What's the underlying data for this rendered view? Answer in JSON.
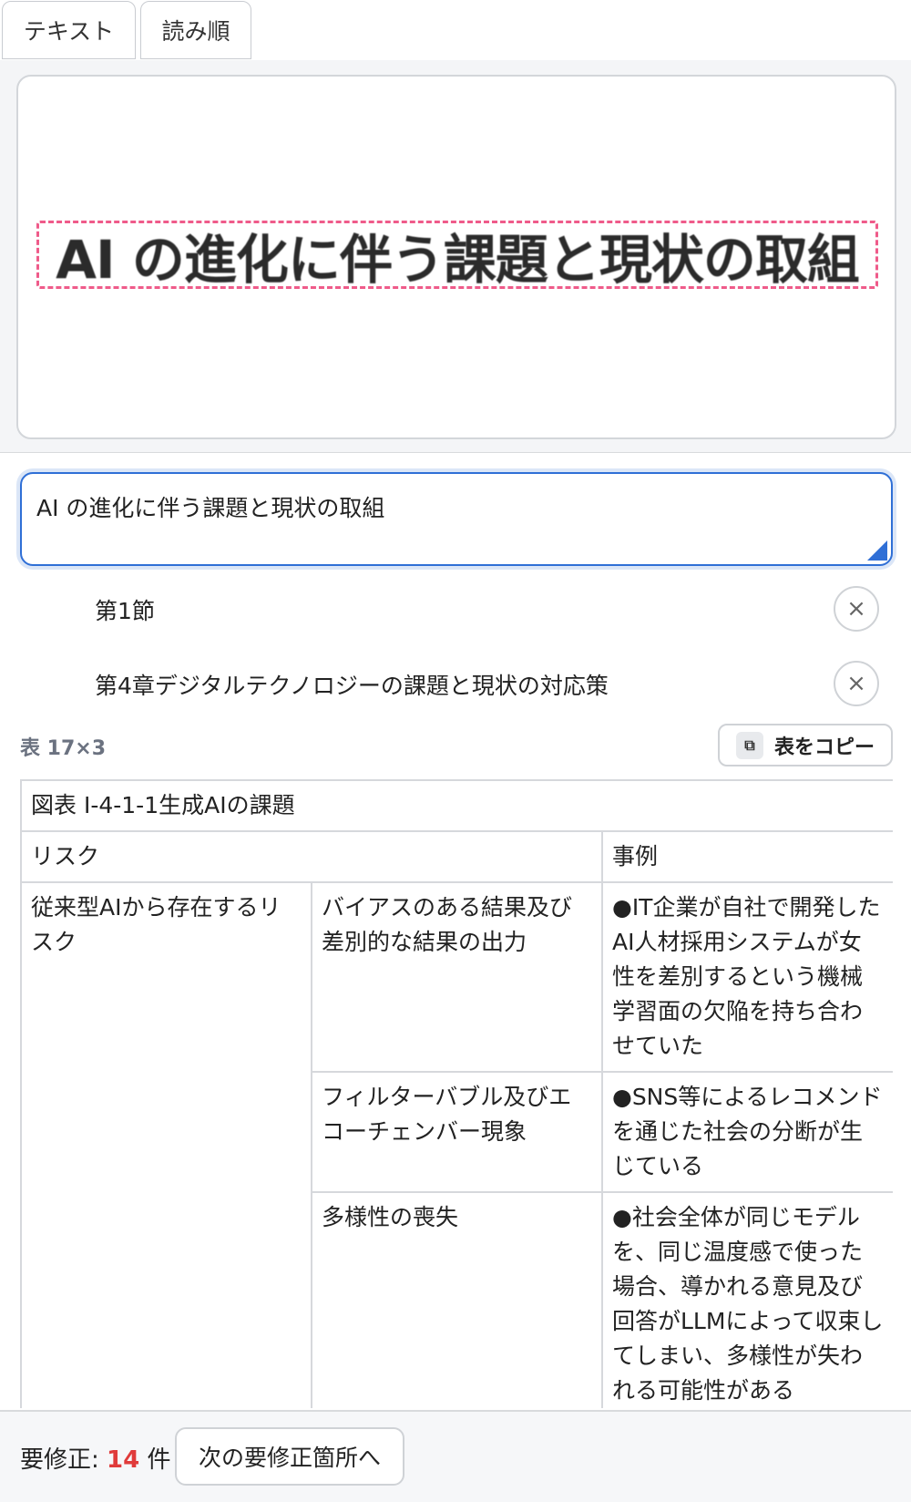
{
  "tabs": {
    "text": "テキスト",
    "reading_order": "読み順"
  },
  "preview": {
    "ocr_text": "AI の進化に伴う課題と現状の取組",
    "highlight_color": "#ef5b8a"
  },
  "editor": {
    "value": "AI の進化に伴う課題と現状の取組",
    "accent": "#2f6fd6"
  },
  "hierarchy": [
    {
      "label": "第1節",
      "close_icon": "×"
    },
    {
      "label": "第4章デジタルテクノロジーの課題と現状の対応策",
      "close_icon": "×"
    }
  ],
  "table_info": {
    "label": "表 17×3",
    "copy_label": "表をコピー",
    "copy_icon": "⧉"
  },
  "table": {
    "caption": "図表 I-4-1-1生成AIの課題",
    "header": {
      "risk": "リスク",
      "example": "事例"
    },
    "group": "従来型AIから存在するリスク",
    "rows": [
      {
        "risk": "バイアスのある結果及び差別的な結果の出力",
        "example": "●IT企業が自社で開発したAI人材採用システムが女性を差別するという機械学習面の欠陥を持ち合わせていた"
      },
      {
        "risk": "フィルターバブル及びエコーチェンバー現象",
        "example": "●SNS等によるレコメンドを通じた社会の分断が生じている"
      },
      {
        "risk": "多様性の喪失",
        "example": "●社会全体が同じモデルを、同じ温度感で使った場合、導かれる意見及び回答がLLMによって収束してしまい、多様性が失われる可能性がある"
      }
    ]
  },
  "bottom": {
    "prefix": "要修正: ",
    "count": "14",
    "suffix": " 件",
    "next_label": "次の要修正箇所へ",
    "count_color": "#e03b3b"
  }
}
